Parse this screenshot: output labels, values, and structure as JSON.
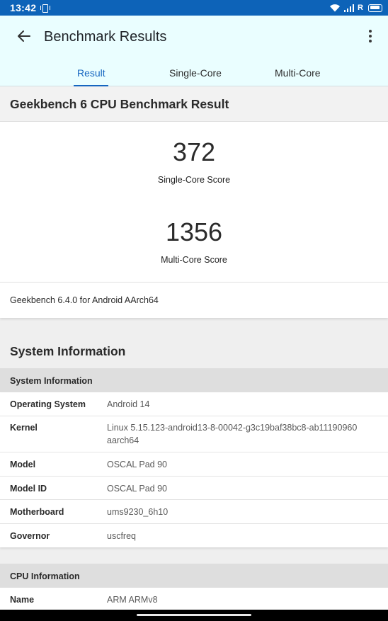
{
  "status_bar": {
    "time": "13:42",
    "network_label": "R"
  },
  "header": {
    "title": "Benchmark Results",
    "tabs": [
      {
        "label": "Result",
        "active": true
      },
      {
        "label": "Single-Core",
        "active": false
      },
      {
        "label": "Multi-Core",
        "active": false
      }
    ]
  },
  "result_card": {
    "title": "Geekbench 6 CPU Benchmark Result",
    "single_core_score": "372",
    "single_core_label": "Single-Core Score",
    "multi_core_score": "1356",
    "multi_core_label": "Multi-Core Score",
    "version": "Geekbench 6.4.0 for Android AArch64"
  },
  "system_section": {
    "title": "System Information",
    "system_table": {
      "header": "System Information",
      "rows": [
        {
          "key": "Operating System",
          "value": "Android 14"
        },
        {
          "key": "Kernel",
          "value": "Linux 5.15.123-android13-8-00042-g3c19baf38bc8-ab11190960 aarch64"
        },
        {
          "key": "Model",
          "value": "OSCAL Pad 90"
        },
        {
          "key": "Model ID",
          "value": "OSCAL Pad 90"
        },
        {
          "key": "Motherboard",
          "value": "ums9230_6h10"
        },
        {
          "key": "Governor",
          "value": "uscfreq"
        }
      ]
    },
    "cpu_table": {
      "header": "CPU Information",
      "rows": [
        {
          "key": "Name",
          "value": "ARM ARMv8"
        }
      ]
    }
  },
  "colors": {
    "status_bar": "#0d63b8",
    "header_bg": "#eafeff",
    "accent": "#1565c0"
  }
}
